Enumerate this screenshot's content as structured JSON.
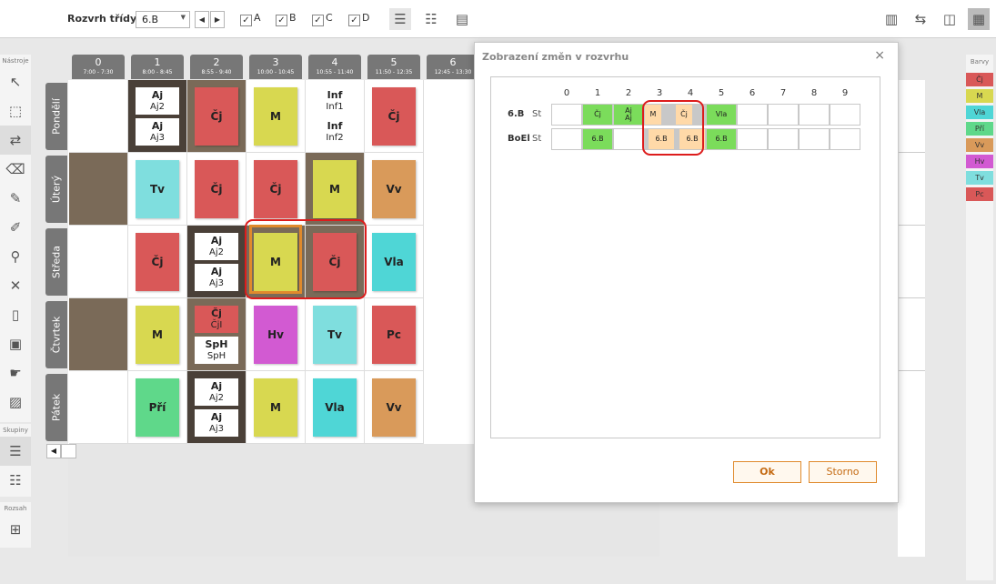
{
  "toolbar": {
    "class_label": "Rozvrh třídy:",
    "class_value": "6.B",
    "prev": "◀",
    "next": "▶",
    "checks": [
      {
        "label": "A",
        "checked": true
      },
      {
        "label": "B",
        "checked": true
      },
      {
        "label": "C",
        "checked": true
      },
      {
        "label": "D",
        "checked": true
      }
    ]
  },
  "sidebar": {
    "tools_caption": "Nástroje",
    "groups_caption": "Skupiny",
    "range_caption": "Rozsah"
  },
  "columns": [
    {
      "n": "0",
      "time": "7:00 - 7:30"
    },
    {
      "n": "1",
      "time": "8:00 - 8:45"
    },
    {
      "n": "2",
      "time": "8:55 - 9:40"
    },
    {
      "n": "3",
      "time": "10:00 - 10:45"
    },
    {
      "n": "4",
      "time": "10:55 - 11:40"
    },
    {
      "n": "5",
      "time": "11:50 - 12:35"
    },
    {
      "n": "6",
      "time": "12:45 - 13:30"
    }
  ],
  "days": [
    "Pondělí",
    "Úterý",
    "Středa",
    "Čtvrtek",
    "Pátek"
  ],
  "timetable": [
    [
      "",
      {
        "split": [
          [
            "Aj",
            "Aj2"
          ],
          [
            "Aj",
            "Aj3"
          ]
        ]
      },
      "Čj",
      "M",
      {
        "split": [
          [
            "Inf",
            "Inf1"
          ],
          [
            "Inf",
            "Inf2"
          ]
        ]
      },
      "Čj"
    ],
    [
      "",
      "Tv",
      "Čj",
      "Čj",
      "M",
      "Vv"
    ],
    [
      "",
      "Čj",
      {
        "split": [
          [
            "Aj",
            "Aj2"
          ],
          [
            "Aj",
            "Aj3"
          ]
        ]
      },
      "M",
      "Čj",
      "Vla"
    ],
    [
      "",
      "M",
      {
        "split": [
          [
            "Čj",
            "ČjI"
          ],
          [
            "SpH",
            "SpH"
          ]
        ]
      },
      "Hv",
      "Tv",
      "Pc"
    ],
    [
      "",
      "Pří",
      {
        "split": [
          [
            "Aj",
            "Aj2"
          ],
          [
            "Aj",
            "Aj3"
          ]
        ]
      },
      "M",
      "Vla",
      "Vv"
    ]
  ],
  "colors": {
    "Čj": "#d95858",
    "M": "#d8d850",
    "Vla": "#4fd6d6",
    "Pří": "#5fd88a",
    "Vv": "#d99a5a",
    "Hv": "#d25ad2",
    "Tv": "#7fdede",
    "Pc": "#d95858",
    "Inf": "#ffffff",
    "Aj": "#ffffff",
    "SpH": "#ffffff",
    "dark": "#7a6a58",
    "accent": "#e08a2c",
    "highlight": "#dd1c1c"
  },
  "legend": {
    "caption": "Barvy",
    "items": [
      {
        "label": "Čj",
        "color": "#d95858"
      },
      {
        "label": "M",
        "color": "#d8d850"
      },
      {
        "label": "Vla",
        "color": "#4fd6d6"
      },
      {
        "label": "Pří",
        "color": "#5fd88a"
      },
      {
        "label": "Vv",
        "color": "#d99a5a"
      },
      {
        "label": "Hv",
        "color": "#d25ad2"
      },
      {
        "label": "Tv",
        "color": "#7fdede"
      },
      {
        "label": "Pc",
        "color": "#d95858"
      }
    ]
  },
  "dialog": {
    "title": "Zobrazení změn v rozvrhu",
    "close": "×",
    "hours": [
      "0",
      "1",
      "2",
      "3",
      "4",
      "5",
      "6",
      "7",
      "8",
      "9"
    ],
    "rows": [
      {
        "label": "6.B",
        "week": "St"
      },
      {
        "label": "BoEl",
        "week": "St"
      }
    ],
    "row1": {
      "c1": "Čj",
      "c2a": "Aj",
      "c2b": "Aj",
      "c3": "M",
      "c4": "Čj",
      "c5": "Vla"
    },
    "row2": {
      "c1": "6.B",
      "c3": "6.B",
      "c4": "6.B",
      "c5": "6.B"
    },
    "ok": "Ok",
    "cancel": "Storno"
  }
}
